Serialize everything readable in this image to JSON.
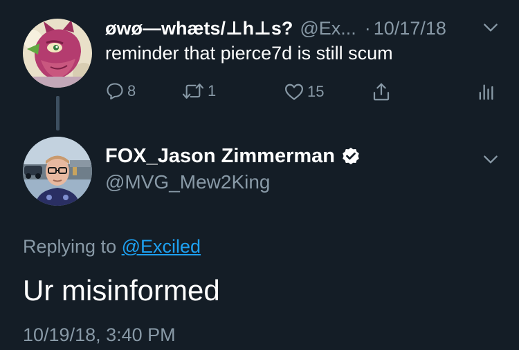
{
  "parent_tweet": {
    "display_name": "øwø—whæts/⊥h⊥s?",
    "handle": "@Ex...",
    "dot": "·",
    "time": "10/17/18",
    "text": "reminder that pierce7d is still scum",
    "reply_count": "8",
    "retweet_count": "1",
    "like_count": "15"
  },
  "reply_tweet": {
    "display_name": "FOX_Jason Zimmerman",
    "handle": "@MVG_Mew2King",
    "replying_prefix": "Replying to",
    "replying_to": "@Exciled",
    "text": "Ur misinformed",
    "timestamp": "10/19/18, 3:40 PM"
  },
  "icons": {
    "reply": "reply-icon",
    "retweet": "retweet-icon",
    "like": "heart-icon",
    "share": "share-icon",
    "analytics": "analytics-icon",
    "menu": "chevron-down-icon",
    "verified": "verified-badge-icon"
  },
  "colors": {
    "background": "#141d26",
    "secondary_text": "#8899a6",
    "link": "#1da1f2",
    "thread_line": "#3d4f60"
  }
}
